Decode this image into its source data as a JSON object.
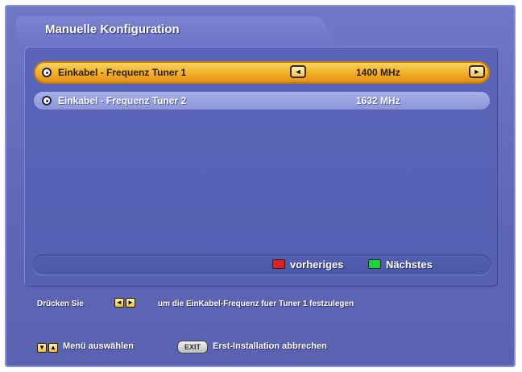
{
  "header": {
    "title": "Manuelle Konfiguration"
  },
  "rows": [
    {
      "label": "Einkabel - Frequenz Tuner 1",
      "value": "1400 MHz",
      "active": true
    },
    {
      "label": "Einkabel - Frequenz Tuner 2",
      "value": "1632 MHz",
      "active": false
    }
  ],
  "footer_nav": {
    "prev_label": "vorheriges",
    "next_label": "Nächstes",
    "red_color": "#e02020",
    "green_color": "#20d040"
  },
  "help": {
    "line1_prefix": "Drücken Sie",
    "line1_suffix": "um die EinKabel-Frequenz fuer Tuner 1 festzulegen",
    "menu_label": "Menü auswählen",
    "exit_label": "EXIT",
    "install_label": "Erst-Installation abbrechen"
  },
  "icons": {
    "left_arrow": "◄",
    "right_arrow": "►",
    "up_arrow": "▲",
    "down_arrow": "▼"
  }
}
